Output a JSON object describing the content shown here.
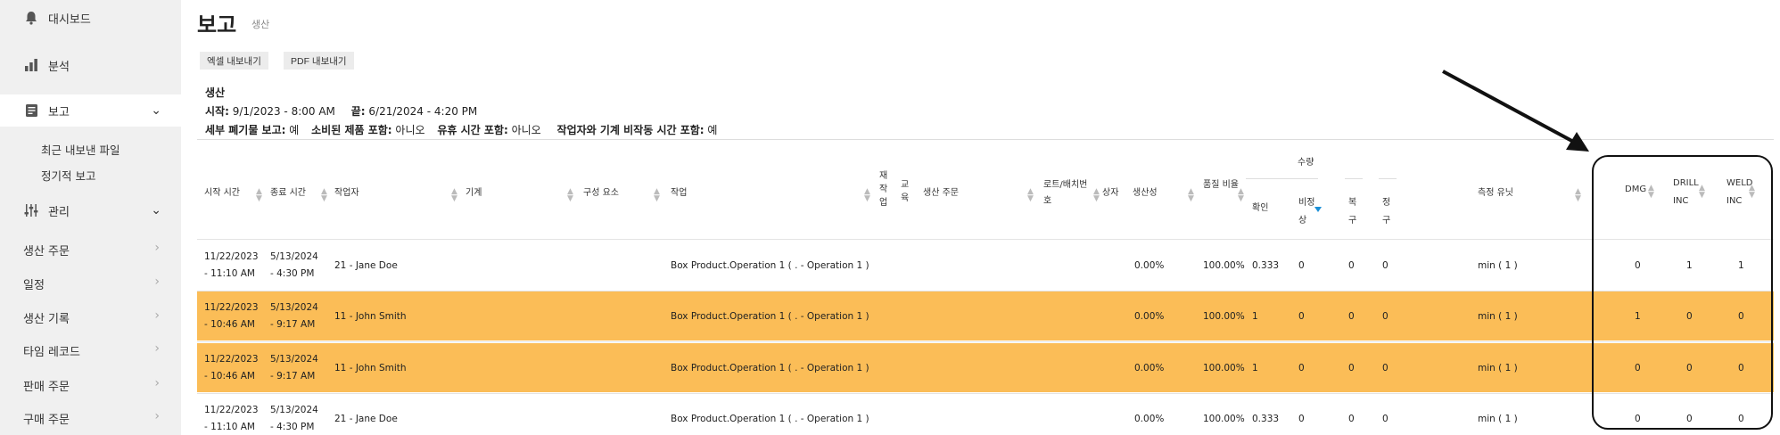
{
  "sidebar": {
    "dashboard": "대시보드",
    "analysis": "분석",
    "report": "보고",
    "report_sub": [
      "최근 내보낸 파일",
      "정기적 보고"
    ],
    "manage": "관리",
    "links": [
      "생산 주문",
      "일정",
      "생산 기록",
      "타임 레코드",
      "판매 주문",
      "구매 주문"
    ]
  },
  "page": {
    "title": "보고",
    "subtitle": "생산"
  },
  "toolbar": {
    "excel": "엑셀 내보내기",
    "pdf": "PDF 내보내기"
  },
  "info": {
    "title": "생산",
    "start_label": "시작:",
    "start_value": "9/1/2023 - 8:00 AM",
    "end_label": "끝:",
    "end_value": "6/21/2024 - 4:20 PM",
    "scrap_label": "세부 폐기물 보고:",
    "scrap_value": "예",
    "consumed_label": "소비된 제품 포함:",
    "consumed_value": "아니오",
    "idle_label": "유휴 시간 포함:",
    "idle_value": "아니오",
    "inactive_label": "작업자와 기계 비작동 시간 포함:",
    "inactive_value": "예"
  },
  "table": {
    "headers": {
      "start": "시작 시간",
      "end": "종료 시간",
      "operator": "작업자",
      "machine": "기계",
      "component": "구성 요소",
      "operation": "작업",
      "rework": "재작업",
      "training": "교육",
      "order": "생산 주문",
      "lot": "로트/배치번호",
      "box": "상자",
      "productivity": "생산성",
      "quality": "품질 비율",
      "qty": "수량",
      "confirm": "확인",
      "abnormal": "비정상",
      "recover": "복구",
      "scrap": "정구",
      "unit": "측정 유닛",
      "dmg": "DMG",
      "drill": "DRILL INC",
      "weld": "WELD INC"
    },
    "rows": [
      {
        "start_date": "11/22/2023",
        "start_time": "- 11:10 AM",
        "end_date": "5/13/2024",
        "end_time": "- 4:30 PM",
        "operator": "21 - Jane Doe",
        "operation": "Box Product.Operation 1 ( . - Operation 1 )",
        "productivity": "0.00%",
        "quality": "100.00%",
        "confirm": "0.333",
        "abnormal": "0",
        "recover": "0",
        "scrap": "0",
        "unit": "min ( 1 )",
        "dmg": "0",
        "drill": "1",
        "weld": "1",
        "highlight": false
      },
      {
        "start_date": "11/22/2023",
        "start_time": "- 10:46 AM",
        "end_date": "5/13/2024",
        "end_time": "- 9:17 AM",
        "operator": "11 - John Smith",
        "operation": "Box Product.Operation 1 ( . - Operation 1 )",
        "productivity": "0.00%",
        "quality": "100.00%",
        "confirm": "1",
        "abnormal": "0",
        "recover": "0",
        "scrap": "0",
        "unit": "min ( 1 )",
        "dmg": "1",
        "drill": "0",
        "weld": "0",
        "highlight": true
      },
      {
        "start_date": "11/22/2023",
        "start_time": "- 10:46 AM",
        "end_date": "5/13/2024",
        "end_time": "- 9:17 AM",
        "operator": "11 - John Smith",
        "operation": "Box Product.Operation 1 ( . - Operation 1 )",
        "productivity": "0.00%",
        "quality": "100.00%",
        "confirm": "1",
        "abnormal": "0",
        "recover": "0",
        "scrap": "0",
        "unit": "min ( 1 )",
        "dmg": "0",
        "drill": "0",
        "weld": "0",
        "highlight": true
      },
      {
        "start_date": "11/22/2023",
        "start_time": "- 11:10 AM",
        "end_date": "5/13/2024",
        "end_time": "- 4:30 PM",
        "operator": "21 - Jane Doe",
        "operation": "Box Product.Operation 1 ( . - Operation 1 )",
        "productivity": "0.00%",
        "quality": "100.00%",
        "confirm": "0.333",
        "abnormal": "0",
        "recover": "0",
        "scrap": "0",
        "unit": "min ( 1 )",
        "dmg": "0",
        "drill": "0",
        "weld": "0",
        "highlight": false
      }
    ]
  },
  "colors": {
    "highlight": "#fbbd57",
    "sidebar_bg": "#f0f0f0",
    "sort_active": "#1a8fd6"
  }
}
